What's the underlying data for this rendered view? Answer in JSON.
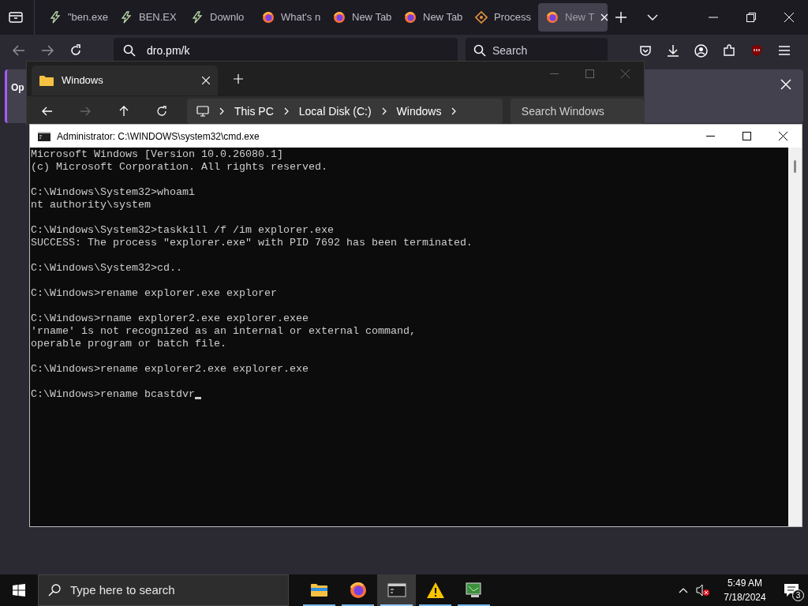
{
  "browser": {
    "tabs": [
      {
        "label": "\"ben.exe",
        "kind": "bolt",
        "selected": false
      },
      {
        "label": "BEN.EX",
        "kind": "bolt",
        "selected": false
      },
      {
        "label": "Downlo",
        "kind": "bolt",
        "selected": false
      },
      {
        "label": "What's n",
        "kind": "firefox",
        "selected": false
      },
      {
        "label": "New Tab",
        "kind": "firefox",
        "selected": false
      },
      {
        "label": "New Tab",
        "kind": "firefox",
        "selected": false
      },
      {
        "label": "Process",
        "kind": "diamond",
        "selected": false
      },
      {
        "label": "New T",
        "kind": "firefox",
        "selected": true
      }
    ],
    "address": "dro.pm/k",
    "search_placeholder": "Search",
    "notification_text": "Op"
  },
  "explorer": {
    "tab_title": "Windows",
    "breadcrumbs": [
      "This PC",
      "Local Disk (C:)",
      "Windows"
    ],
    "search_placeholder": "Search Windows"
  },
  "cmd": {
    "title": "Administrator: C:\\WINDOWS\\system32\\cmd.exe",
    "blocks": [
      [
        "Microsoft Windows [Version 10.0.26080.1]",
        "(c) Microsoft Corporation. All rights reserved."
      ],
      [
        "C:\\Windows\\System32>whoami",
        "nt authority\\system"
      ],
      [
        "C:\\Windows\\System32>taskkill /f /im explorer.exe",
        "SUCCESS: The process \"explorer.exe\" with PID 7692 has been terminated."
      ],
      [
        "C:\\Windows\\System32>cd.."
      ],
      [
        "C:\\Windows>rename explorer.exe explorer"
      ],
      [
        "C:\\Windows>rname explorer2.exe explorer.exee",
        "'rname' is not recognized as an internal or external command,",
        "operable program or batch file."
      ],
      [
        "C:\\Windows>rename explorer2.exe explorer.exe"
      ],
      [
        "C:\\Windows>rename bcastdvr"
      ]
    ]
  },
  "taskbar": {
    "search_placeholder": "Type here to search",
    "apps": [
      {
        "kind": "folder",
        "selected": false
      },
      {
        "kind": "firefox",
        "selected": false
      },
      {
        "kind": "terminal",
        "selected": true
      },
      {
        "kind": "warning",
        "selected": false
      },
      {
        "kind": "monitor",
        "selected": false
      }
    ],
    "time": "5:49 AM",
    "date": "7/18/2024",
    "notification_count": "3"
  }
}
